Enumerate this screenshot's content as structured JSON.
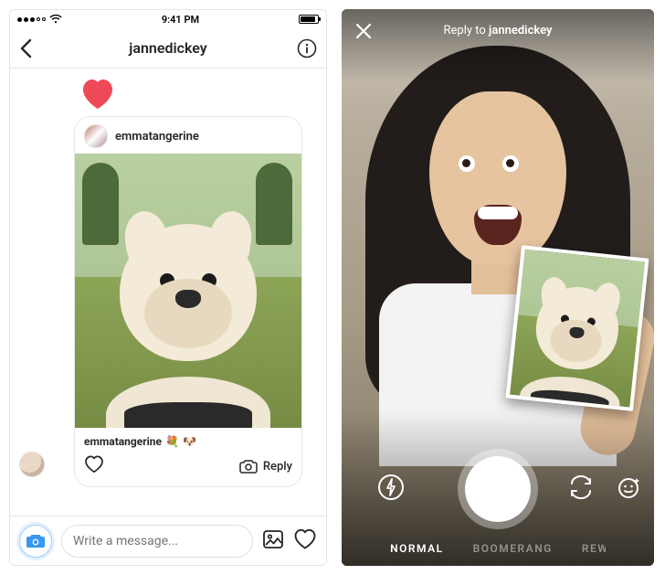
{
  "left": {
    "status": {
      "time": "9:41 PM"
    },
    "nav": {
      "title": "jannedickey"
    },
    "heart_icon": "heart-icon",
    "card": {
      "author": "emmatangerine",
      "caption_user": "emmatangerine",
      "caption_emoji_1": "💐",
      "caption_emoji_2": "🐶",
      "reply_label": "Reply"
    },
    "composer": {
      "placeholder": "Write a message..."
    }
  },
  "right": {
    "reply_prefix": "Reply to ",
    "reply_user": "jannedickey",
    "modes": {
      "normal": "NORMAL",
      "boomerang": "BOOMERANG",
      "rewind_partial": "REW"
    }
  }
}
